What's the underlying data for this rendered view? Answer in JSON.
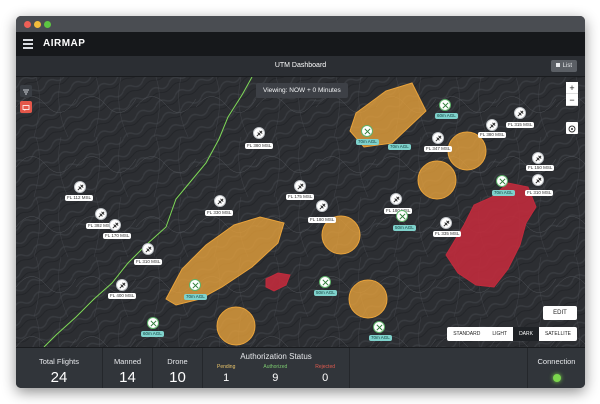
{
  "app": {
    "brand": "AIRMAP",
    "dashboard_title": "UTM Dashboard",
    "list_label": "List"
  },
  "map": {
    "viewing_label": "Viewing: NOW + 0 Minutes",
    "zoom_in": "+",
    "zoom_out": "−",
    "edit_label": "EDIT",
    "basemaps": [
      "STANDARD",
      "LIGHT",
      "DARK",
      "SATELLITE"
    ],
    "active_basemap": "DARK",
    "flight_labels": [
      "FL 380 MSL",
      "FL 112 MSL",
      "FL 392 MSL",
      "FL 330 MSL",
      "FL 175 MSL",
      "FL 180 MSL",
      "FL 170 MSL",
      "FL 310 MSL",
      "FL 400 MSL",
      "FL 347 MSL",
      "FL 380 MSL",
      "FL 315 MSL",
      "FL 310 MSL",
      "FL 150 MSL",
      "FL 180 MSL",
      "FL 335 MSL"
    ],
    "drone_labels": [
      "70m AGL",
      "70m AGL",
      "60m AGL",
      "70m AGL",
      "50m AGL",
      "70m AGL",
      "50m AGL",
      "60m AGL",
      "70m AGL"
    ]
  },
  "stats": {
    "total_flights": {
      "label": "Total Flights",
      "value": "24"
    },
    "manned": {
      "label": "Manned",
      "value": "14"
    },
    "drone": {
      "label": "Drone",
      "value": "10"
    },
    "authorization": {
      "title": "Authorization Status",
      "pending": {
        "label": "Pending",
        "value": "1"
      },
      "authorized": {
        "label": "Authorized",
        "value": "9"
      },
      "rejected": {
        "label": "Rejected",
        "value": "0"
      }
    },
    "connection": {
      "label": "Connection"
    }
  },
  "colors": {
    "zone_orange": "#e9a33b",
    "zone_red": "#c02b3c",
    "route_green": "#7ed957",
    "pending": "#e9c46a",
    "authorized": "#7bc96f",
    "rejected": "#e05a4f",
    "connection": "#7cd64d"
  }
}
